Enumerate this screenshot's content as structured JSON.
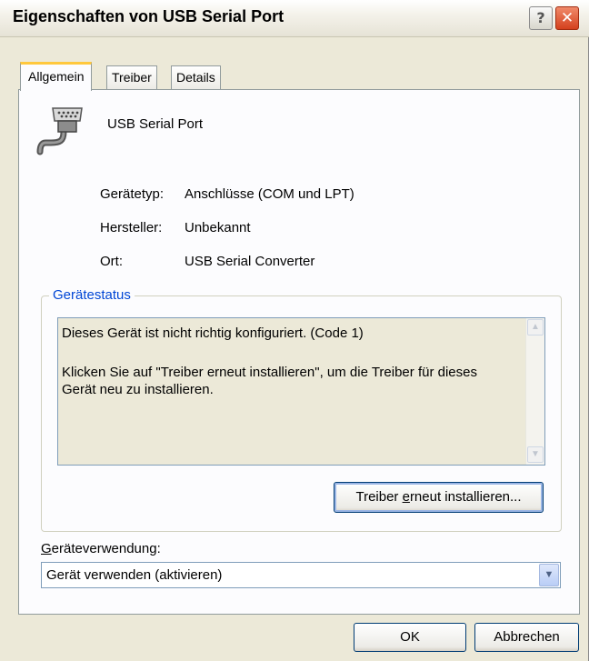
{
  "window": {
    "title": "Eigenschaften von USB Serial Port",
    "help_glyph": "?",
    "close_glyph": "✕"
  },
  "tabs": [
    {
      "label": "Allgemein",
      "active": true
    },
    {
      "label": "Treiber",
      "active": false
    },
    {
      "label": "Details",
      "active": false
    }
  ],
  "device": {
    "name": "USB Serial Port",
    "icon": "serial-port-connector-icon"
  },
  "properties": {
    "type_label": "Gerätetyp:",
    "type_value": "Anschlüsse (COM und LPT)",
    "manufacturer_label": "Hersteller:",
    "manufacturer_value": "Unbekannt",
    "location_label": "Ort:",
    "location_value": "USB Serial Converter"
  },
  "status": {
    "group_title": "Gerätestatus",
    "line1": "Dieses Gerät ist nicht richtig konfiguriert. (Code 1)",
    "line2": "Klicken Sie auf \"Treiber erneut installieren\", um die Treiber für dieses Gerät neu zu installieren."
  },
  "buttons": {
    "reinstall_pre": "Treiber ",
    "reinstall_hotkey": "e",
    "reinstall_post": "rneut installieren...",
    "ok": "OK",
    "cancel": "Abbrechen"
  },
  "usage": {
    "label_hotkey": "G",
    "label_rest": "eräteverwendung:",
    "selected": "Gerät verwenden (aktivieren)"
  },
  "colors": {
    "dialog_bg": "#ece9d8",
    "legend_blue": "#0046d5",
    "close_red": "#d4401d",
    "active_tab_accent": "#ffc83c"
  }
}
